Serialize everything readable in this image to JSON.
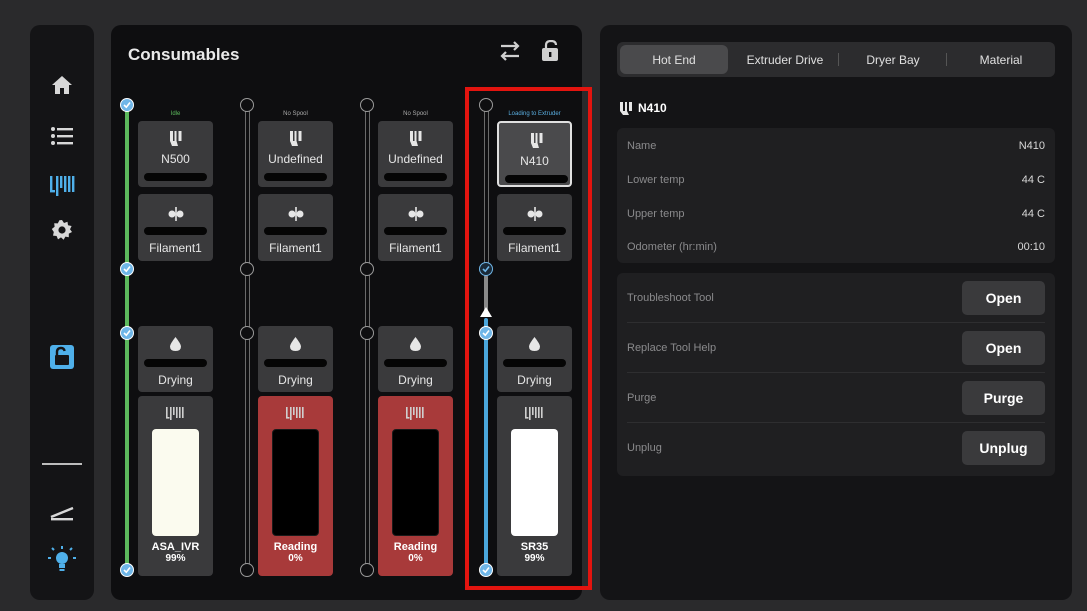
{
  "sidebar": {
    "items": [
      {
        "name": "home-icon"
      },
      {
        "name": "list-icon"
      },
      {
        "name": "consumables-icon"
      },
      {
        "name": "settings-icon"
      },
      {
        "name": "unlock-icon"
      },
      {
        "name": "divider"
      },
      {
        "name": "ramp-icon"
      },
      {
        "name": "light-icon"
      }
    ]
  },
  "consumables": {
    "title": "Consumables",
    "columns": [
      {
        "status": "Idle",
        "tool": "N500",
        "drive": "Filament1",
        "dryer": "Drying",
        "material": "ASA_IVR",
        "level": "99%",
        "state": "ok"
      },
      {
        "status": "No Spool",
        "tool": "Undefined",
        "drive": "Filament1",
        "dryer": "Drying",
        "material": "Reading",
        "level": "0%",
        "state": "error"
      },
      {
        "status": "No Spool",
        "tool": "Undefined",
        "drive": "Filament1",
        "dryer": "Drying",
        "material": "Reading",
        "level": "0%",
        "state": "error"
      },
      {
        "status": "Loading to Extruder",
        "tool": "N410",
        "drive": "Filament1",
        "dryer": "Drying",
        "material": "SR35",
        "level": "99%",
        "state": "loading"
      }
    ]
  },
  "detail": {
    "tabs": [
      "Hot End",
      "Extruder Drive",
      "Dryer Bay",
      "Material"
    ],
    "active_tab": "Hot End",
    "tool_title": "N410",
    "info": [
      {
        "key": "Name",
        "value": "N410"
      },
      {
        "key": "Lower temp",
        "value": "44 C"
      },
      {
        "key": "Upper temp",
        "value": "44 C"
      },
      {
        "key": "Odometer (hr:min)",
        "value": "00:10"
      }
    ],
    "actions": [
      {
        "key": "Troubleshoot Tool",
        "button": "Open"
      },
      {
        "key": "Replace Tool Help",
        "button": "Open"
      },
      {
        "key": "Purge",
        "button": "Purge"
      },
      {
        "key": "Unplug",
        "button": "Unplug"
      }
    ]
  },
  "colors": {
    "accent_green": "#5cb85c",
    "accent_blue": "#5aaee0",
    "error_red": "#a83a3a",
    "highlight": "#e3140f"
  }
}
